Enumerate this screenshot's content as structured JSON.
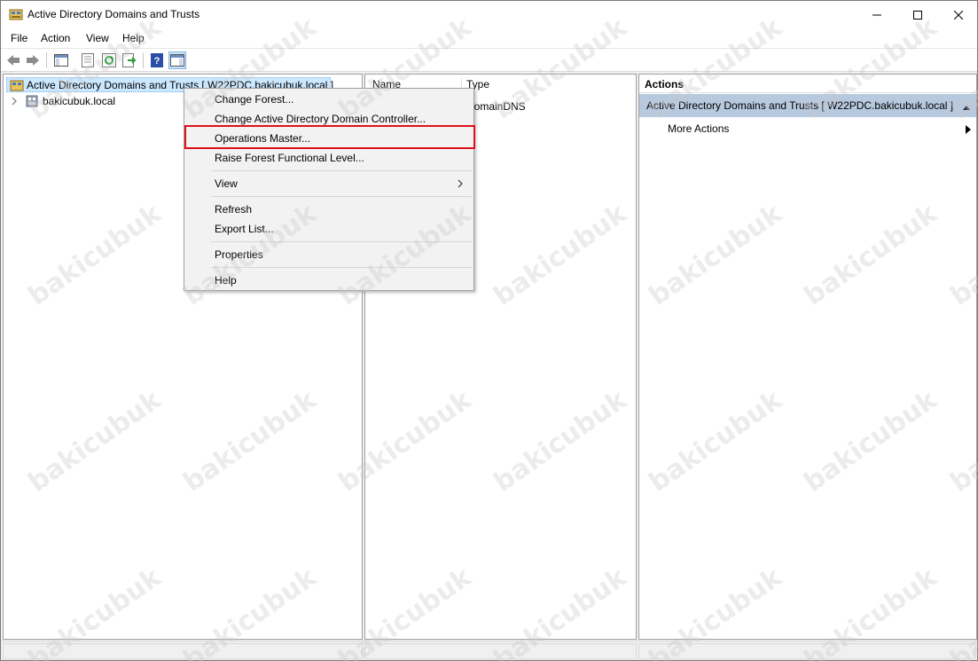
{
  "window": {
    "title": "Active Directory Domains and Trusts"
  },
  "menubar": {
    "items": [
      {
        "label": "File"
      },
      {
        "label": "Action"
      },
      {
        "label": "View"
      },
      {
        "label": "Help"
      }
    ]
  },
  "toolbar": {
    "icons": [
      "back-arrow-icon",
      "forward-arrow-icon",
      "show-hide-console-tree-icon",
      "properties-icon",
      "refresh-icon",
      "export-list-icon",
      "help-icon",
      "show-hide-action-pane-icon"
    ]
  },
  "tree": {
    "root_label": "Active Directory Domains and Trusts [ W22PDC.bakicubuk.local ]",
    "child_label": "bakicubuk.local"
  },
  "results": {
    "columns": [
      "Name",
      "Type"
    ],
    "rows": [
      {
        "name": "",
        "type": "DomainDNS"
      }
    ]
  },
  "actions": {
    "header": "Actions",
    "section_title": "Active Directory Domains and Trusts [ W22PDC.bakicubuk.local ]",
    "more_actions": "More Actions"
  },
  "context_menu": {
    "items": [
      {
        "label": "Change Forest..."
      },
      {
        "label": "Change Active Directory Domain Controller..."
      },
      {
        "label": "Operations Master..."
      },
      {
        "label": "Raise Forest Functional Level..."
      },
      {
        "label": "View"
      },
      {
        "label": "Refresh"
      },
      {
        "label": "Export List..."
      },
      {
        "label": "Properties"
      },
      {
        "label": "Help"
      }
    ],
    "highlighted": "Operations Master...",
    "highlight_color": "#e0101a"
  },
  "watermark": "bakicubuk"
}
